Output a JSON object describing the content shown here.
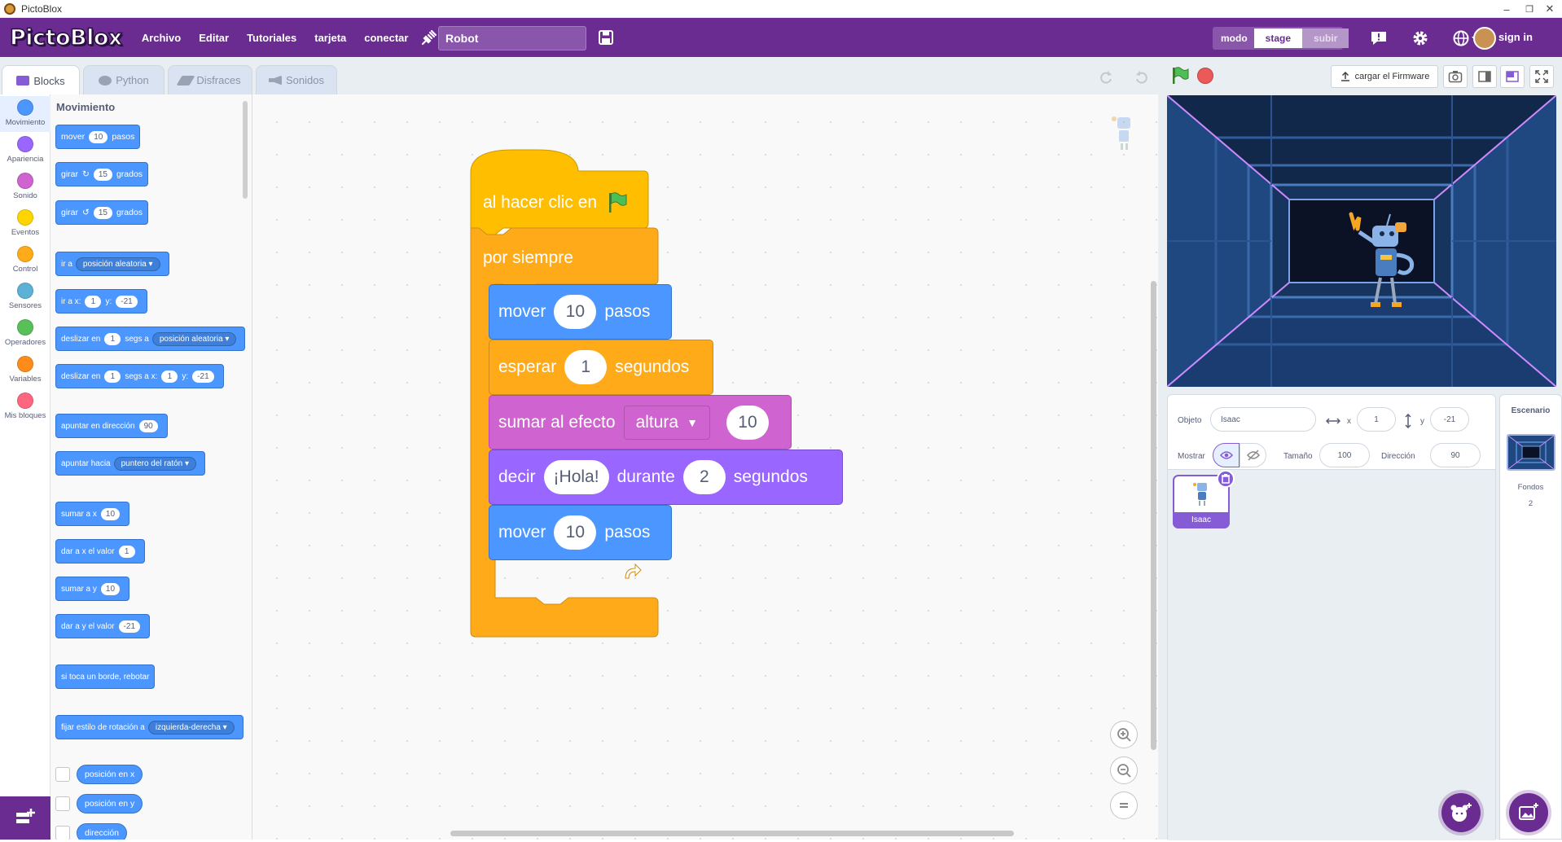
{
  "window": {
    "title": "PictoBlox"
  },
  "menu": {
    "logo": "PictoBlox",
    "items": [
      "Archivo",
      "Editar",
      "Tutoriales",
      "tarjeta",
      "conectar"
    ],
    "project_name": "Robot",
    "mode_label": "modo",
    "mode_stage": "stage",
    "mode_upload": "subir",
    "sign_in": "sign in"
  },
  "tabs": {
    "blocks": "Blocks",
    "python": "Python",
    "costumes": "Disfraces",
    "sounds": "Sonidos"
  },
  "categories": [
    {
      "label": "Movimiento",
      "color": "#4c97ff"
    },
    {
      "label": "Apariencia",
      "color": "#9966ff"
    },
    {
      "label": "Sonido",
      "color": "#cf63cf"
    },
    {
      "label": "Eventos",
      "color": "#ffd500"
    },
    {
      "label": "Control",
      "color": "#ffab19"
    },
    {
      "label": "Sensores",
      "color": "#5cb1d6"
    },
    {
      "label": "Operadores",
      "color": "#59c059"
    },
    {
      "label": "Variables",
      "color": "#ff8c1a"
    },
    {
      "label": "Mis bloques",
      "color": "#ff6680"
    }
  ],
  "palette": {
    "title": "Movimiento",
    "move": {
      "a": "mover",
      "n": "10",
      "b": "pasos"
    },
    "turn_right": {
      "a": "girar",
      "n": "15",
      "b": "grados"
    },
    "turn_left": {
      "a": "girar",
      "n": "15",
      "b": "grados"
    },
    "goto": {
      "a": "ir a",
      "dd": "posición aleatoria"
    },
    "goto_xy": {
      "a": "ir a x:",
      "x": "1",
      "b": "y:",
      "y": "-21"
    },
    "glide": {
      "a": "deslizar en",
      "n": "1",
      "b": "segs a",
      "dd": "posición aleatoria"
    },
    "glide_xy": {
      "a": "deslizar en",
      "n": "1",
      "b": "segs a x:",
      "x": "1",
      "c": "y:",
      "y": "-21"
    },
    "point_dir": {
      "a": "apuntar en dirección",
      "n": "90"
    },
    "point_towards": {
      "a": "apuntar hacia",
      "dd": "puntero del ratón"
    },
    "change_x": {
      "a": "sumar a x",
      "n": "10"
    },
    "set_x": {
      "a": "dar a x el valor",
      "n": "1"
    },
    "change_y": {
      "a": "sumar a y",
      "n": "10"
    },
    "set_y": {
      "a": "dar a y el valor",
      "n": "-21"
    },
    "bounce": "si toca un borde, rebotar",
    "rotation": {
      "a": "fijar estilo de rotación a",
      "dd": "izquierda-derecha"
    },
    "rep_x": "posición en x",
    "rep_y": "posición en y",
    "rep_dir": "dirección"
  },
  "script": {
    "hat": "al hacer clic en",
    "forever": "por siempre",
    "b1": {
      "a": "mover",
      "n": "10",
      "b": "pasos"
    },
    "b2": {
      "a": "esperar",
      "n": "1",
      "b": "segundos"
    },
    "b3": {
      "a": "sumar al efecto",
      "dd": "altura",
      "n": "10"
    },
    "b4": {
      "a": "decir",
      "s": "¡Hola!",
      "b": "durante",
      "n": "2",
      "c": "segundos"
    },
    "b5": {
      "a": "mover",
      "n": "10",
      "b": "pasos"
    }
  },
  "stage_toolbar": {
    "firmware": "cargar el Firmware"
  },
  "sprite_info": {
    "object_label": "Objeto",
    "object_name": "Isaac",
    "x_label": "x",
    "x": "1",
    "y_label": "y",
    "y": "-21",
    "show_label": "Mostrar",
    "size_label": "Tamaño",
    "size": "100",
    "direction_label": "Dirección",
    "direction": "90"
  },
  "sprites": [
    {
      "name": "Isaac"
    }
  ],
  "stage_panel": {
    "title": "Escenario",
    "backdrops_label": "Fondos",
    "backdrops_count": "2"
  },
  "colors": {
    "brand": "#6a2c91",
    "motion": "#4c97ff",
    "control": "#ffab19",
    "events": "#ffbf00",
    "looks": "#9966ff"
  }
}
